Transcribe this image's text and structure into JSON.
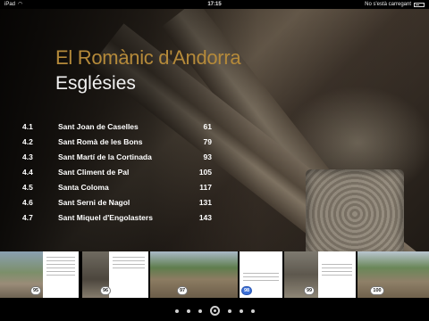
{
  "status_bar": {
    "device": "iPad",
    "time": "17:15",
    "loading_text": "No s'està carregant"
  },
  "book": {
    "title": "El Romànic d'Andorra",
    "section": "Esglésies"
  },
  "toc": [
    {
      "num": "4.1",
      "name": "Sant Joan de Caselles",
      "page": "61"
    },
    {
      "num": "4.2",
      "name": "Sant Romà de les Bons",
      "page": "79"
    },
    {
      "num": "4.3",
      "name": "Sant Martí de la Cortinada",
      "page": "93"
    },
    {
      "num": "4.4",
      "name": "Sant Climent de Pal",
      "page": "105"
    },
    {
      "num": "4.5",
      "name": "Santa Coloma",
      "page": "117"
    },
    {
      "num": "4.6",
      "name": "Sant Serni de Nagol",
      "page": "131"
    },
    {
      "num": "4.7",
      "name": "Sant Miquel d'Engolasters",
      "page": "143"
    }
  ],
  "thumbnails": [
    {
      "page": "95"
    },
    {
      "page": "96"
    },
    {
      "page": "97"
    },
    {
      "page": "98"
    },
    {
      "page": "99"
    },
    {
      "page": "100"
    }
  ],
  "colors": {
    "title_gold": "#b58a3a",
    "active_badge": "#3b6fd6"
  }
}
